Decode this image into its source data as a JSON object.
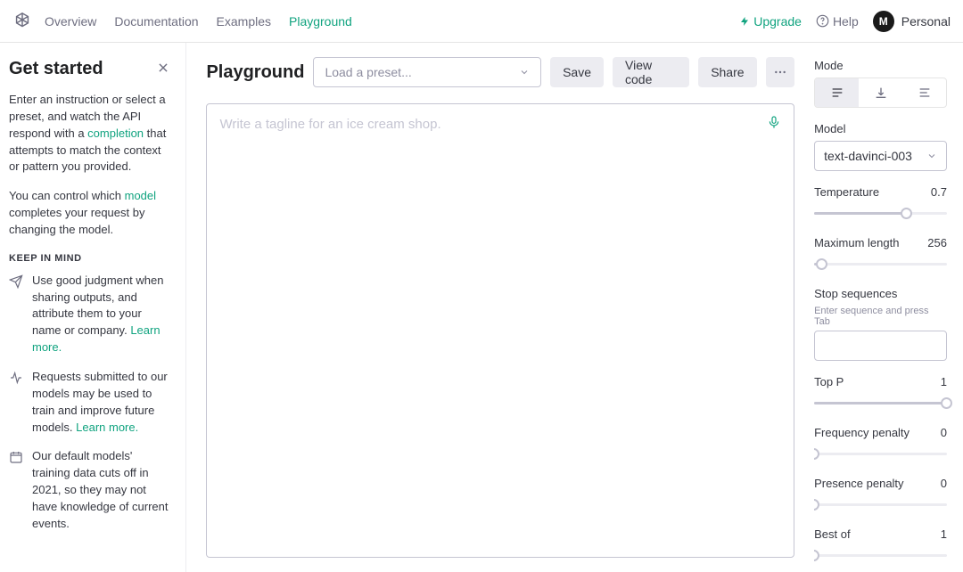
{
  "header": {
    "nav": [
      "Overview",
      "Documentation",
      "Examples",
      "Playground"
    ],
    "active_nav": 3,
    "upgrade": "Upgrade",
    "help": "Help",
    "avatar_initial": "M",
    "account_label": "Personal"
  },
  "sidebar": {
    "title": "Get started",
    "intro_1a": "Enter an instruction or select a preset, and watch the API respond with a ",
    "intro_link1": "completion",
    "intro_1b": " that attempts to match the context or pattern you provided.",
    "intro_2a": "You can control which ",
    "intro_link2": "model",
    "intro_2b": " completes your request by changing the model.",
    "subhead": "KEEP IN MIND",
    "tip1": "Use good judgment when sharing outputs, and attribute them to your name or company. ",
    "tip1_link": "Learn more.",
    "tip2": "Requests submitted to our models may be used to train and improve future models. ",
    "tip2_link": "Learn more.",
    "tip3": "Our default models' training data cuts off in 2021, so they may not have knowledge of current events."
  },
  "playground": {
    "title": "Playground",
    "preset_placeholder": "Load a preset...",
    "save": "Save",
    "view_code": "View code",
    "share": "Share",
    "prompt_placeholder": "Write a tagline for an ice cream shop."
  },
  "settings": {
    "mode_label": "Mode",
    "model_label": "Model",
    "model_value": "text-davinci-003",
    "temperature_label": "Temperature",
    "temperature_value": "0.7",
    "maxlen_label": "Maximum length",
    "maxlen_value": "256",
    "stop_label": "Stop sequences",
    "stop_hint": "Enter sequence and press Tab",
    "topp_label": "Top P",
    "topp_value": "1",
    "freq_label": "Frequency penalty",
    "freq_value": "0",
    "pres_label": "Presence penalty",
    "pres_value": "0",
    "bestof_label": "Best of",
    "bestof_value": "1"
  }
}
